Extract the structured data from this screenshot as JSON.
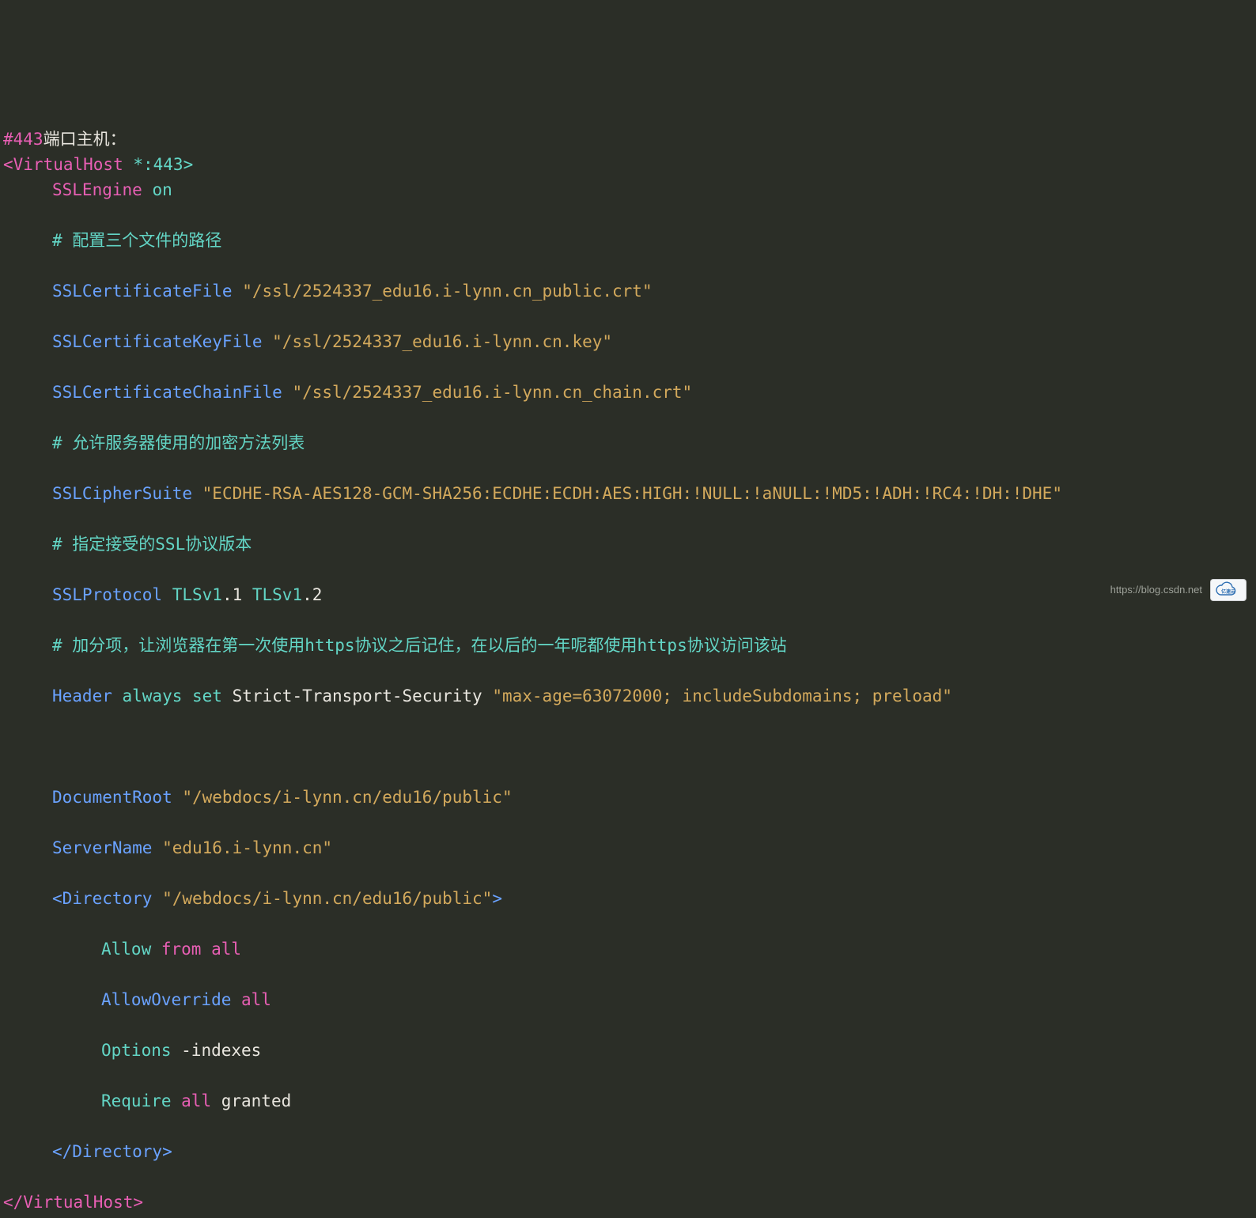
{
  "code": {
    "l1_hash": "#443",
    "l1_rest": "端口主机：",
    "l2_open": "<VirtualHost",
    "l2_arg": " *:443>",
    "l3_k": "SSLEngine",
    "l3_v": " on",
    "l4_cmt": "# 配置三个文件的路径",
    "l5_k": "SSLCertificateFile",
    "l5_v": " \"/ssl/2524337_edu16.i-lynn.cn_public.crt\"",
    "l6_k": "SSLCertificateKeyFile",
    "l6_v": " \"/ssl/2524337_edu16.i-lynn.cn.key\"",
    "l7_k": "SSLCertificateChainFile",
    "l7_v": " \"/ssl/2524337_edu16.i-lynn.cn_chain.crt\"",
    "l8_cmt": "# 允许服务器使用的加密方法列表",
    "l9_k": "SSLCipherSuite",
    "l9_v": " \"ECDHE-RSA-AES128-GCM-SHA256:ECDHE:ECDH:AES:HIGH:!NULL:!aNULL:!MD5:!ADH:!RC4:!DH:!DHE\"",
    "l10_cmt": "# 指定接受的SSL协议版本",
    "l11_k": "SSLProtocol",
    "l11_a": " TLSv1",
    "l11_b": ".1",
    "l11_c": " TLSv1",
    "l11_d": ".2",
    "l12_cmt": "# 加分项，让浏览器在第一次使用https协议之后记住，在以后的一年呢都使用https协议访问该站",
    "l13_k": "Header",
    "l13_m1": " always",
    "l13_m2": " set",
    "l13_m3": " Strict-Transport-Security",
    "l13_v": " \"max-age=63072000; includeSubdomains; preload\"",
    "blank": " ",
    "l15_k": "DocumentRoot",
    "l15_v": " \"/webdocs/i-lynn.cn/edu16/public\"",
    "l16_k": "ServerName",
    "l16_v": " \"edu16.i-lynn.cn\"",
    "l17_open": "<Directory",
    "l17_v": " \"/webdocs/i-lynn.cn/edu16/public\"",
    "l17_close": ">",
    "l18_a": "Allow",
    "l18_b": " from",
    "l18_c": " all",
    "l19_a": "AllowOverride",
    "l19_b": " all",
    "l20_a": "Options",
    "l20_b": " -indexes",
    "l21_a": "Require",
    "l21_b": " all",
    "l21_c": " granted",
    "l22": "</Directory>",
    "l23": "</VirtualHost>"
  },
  "watermark": {
    "url": "https://blog.csdn.net",
    "logo_text": "亿速云"
  }
}
